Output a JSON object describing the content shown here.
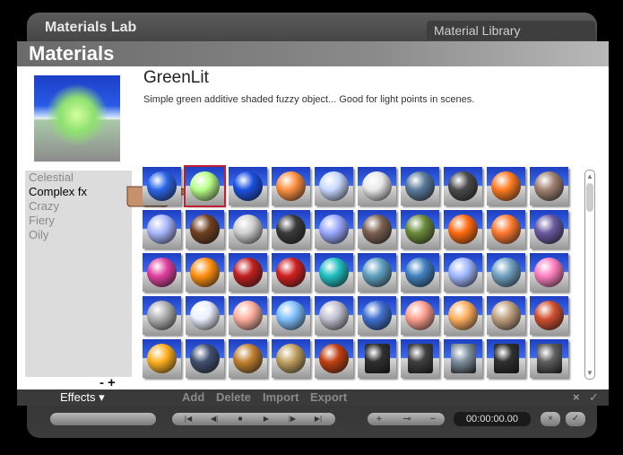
{
  "window": {
    "title": "Materials Lab",
    "library_tab": "Material Library"
  },
  "panel": {
    "header": "Materials"
  },
  "material": {
    "name": "GreenLit",
    "description": "Simple green additive shaded fuzzy object... Good for light points in scenes."
  },
  "categories": [
    "Celestial",
    "Complex fx",
    "Crazy",
    "Fiery",
    "Oily"
  ],
  "selected_category": "Complex fx",
  "category_controls": {
    "remove": "-",
    "add": "+"
  },
  "grid_rows": [
    [
      "#2a66e8",
      "#b8ff88",
      "#1a50e0",
      "#ff9040",
      "#c8d8ff",
      "#e8e8e8",
      "#5a7a9a",
      "#4a4a4a",
      "#ff7a20",
      "#a08070"
    ],
    [
      "#aab8ff",
      "#704020",
      "#d0d0d0",
      "#3a3a3a",
      "#9aa8ff",
      "#7a6050",
      "#6a8a3a",
      "#ff6a10",
      "#ff7a30",
      "#6a5aa0"
    ],
    [
      "#e040a0",
      "#ff9010",
      "#c02020",
      "#d02020",
      "#20c0c0",
      "#60a0c0",
      "#4080c0",
      "#a0b8ff",
      "#70a0c0",
      "#ff80c0"
    ],
    [
      "#b0b0b0",
      "#eaf0ff",
      "#ffb0a0",
      "#80c0ff",
      "#c0c0d0",
      "#4070d0",
      "#ffa090",
      "#ffb060",
      "#c0a080",
      "#d05030"
    ],
    [
      "#ffb020",
      "#405070",
      "#c08030",
      "#c0a060",
      "#c04010",
      "#303030",
      "#404040",
      "#8090a0",
      "#303030",
      "#606060"
    ]
  ],
  "grid_cylinder_cols_row5": [
    5,
    6,
    7,
    8,
    9
  ],
  "selected_cell": [
    0,
    1
  ],
  "bottom_bar": {
    "effects_label": "Effects",
    "actions": [
      "Add",
      "Delete",
      "Import",
      "Export"
    ],
    "cancel": "×",
    "ok": "✓"
  },
  "transport": {
    "buttons": [
      "|◀",
      "◀|",
      "■",
      "▶",
      "|▶",
      "▶|"
    ],
    "zoom_in": "+",
    "key": "⊸",
    "zoom_out": "−",
    "time": "00:00:00.00",
    "close": "×",
    "ok": "✓"
  }
}
